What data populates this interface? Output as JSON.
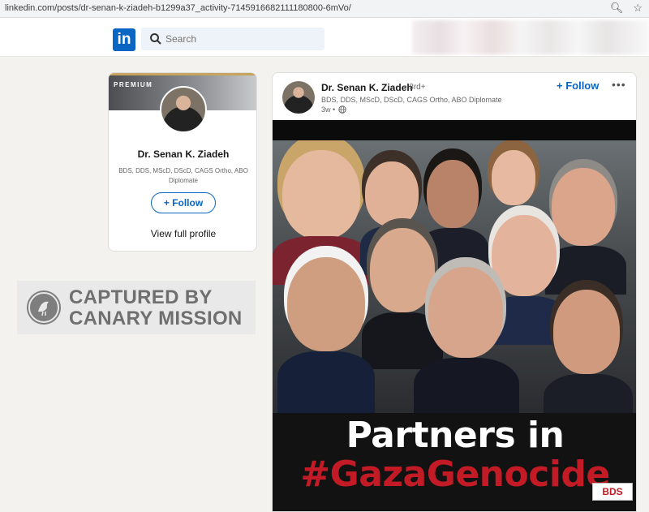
{
  "browser": {
    "url": "linkedin.com/posts/dr-senan-k-ziadeh-b1299a37_activity-7145916682111180800-6mVo/",
    "zoom_icon": "zoom-icon",
    "star_icon": "star-icon"
  },
  "header": {
    "logo": "in",
    "search_placeholder": "Search"
  },
  "profile_card": {
    "badge": "PREMIUM",
    "name": "Dr. Senan K. Ziadeh",
    "headline": "BDS, DDS, MScD, DScD, CAGS Ortho, ABO Diplomate",
    "follow_label": "+ Follow",
    "view_profile_label": "View full profile"
  },
  "watermark": {
    "line1": "CAPTURED BY",
    "line2": "CANARY MISSION"
  },
  "post": {
    "author": "Dr. Senan K. Ziadeh",
    "degree": "• 3rd+",
    "headline": "BDS, DDS, MScD, DScD, CAGS Ortho, ABO Diplomate",
    "time": "3w •",
    "follow_label": "+ Follow",
    "more_label": "•••",
    "image_caption_line1": "Partners in",
    "image_caption_line2": "#GazaGenocide",
    "image_logo": "BDS"
  },
  "colors": {
    "linkedin_blue": "#0a66c2",
    "caption_red": "#c21b26",
    "page_bg": "#f3f2ef"
  }
}
